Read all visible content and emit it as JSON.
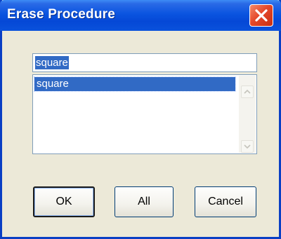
{
  "window": {
    "title": "Erase Procedure"
  },
  "name_field": {
    "value": "square"
  },
  "procedure_list": {
    "items": [
      "square"
    ],
    "selected_index": 0
  },
  "buttons": {
    "ok_label": "OK",
    "all_label": "All",
    "cancel_label": "Cancel"
  },
  "icons": {
    "close": "close-icon",
    "scroll_up": "scroll-up-arrow-icon",
    "scroll_down": "scroll-down-arrow-icon"
  },
  "colors": {
    "titlebar": "#0a54e0",
    "selection": "#316ac5",
    "close_button": "#e5482a",
    "dialog_background": "#ece9d8"
  }
}
